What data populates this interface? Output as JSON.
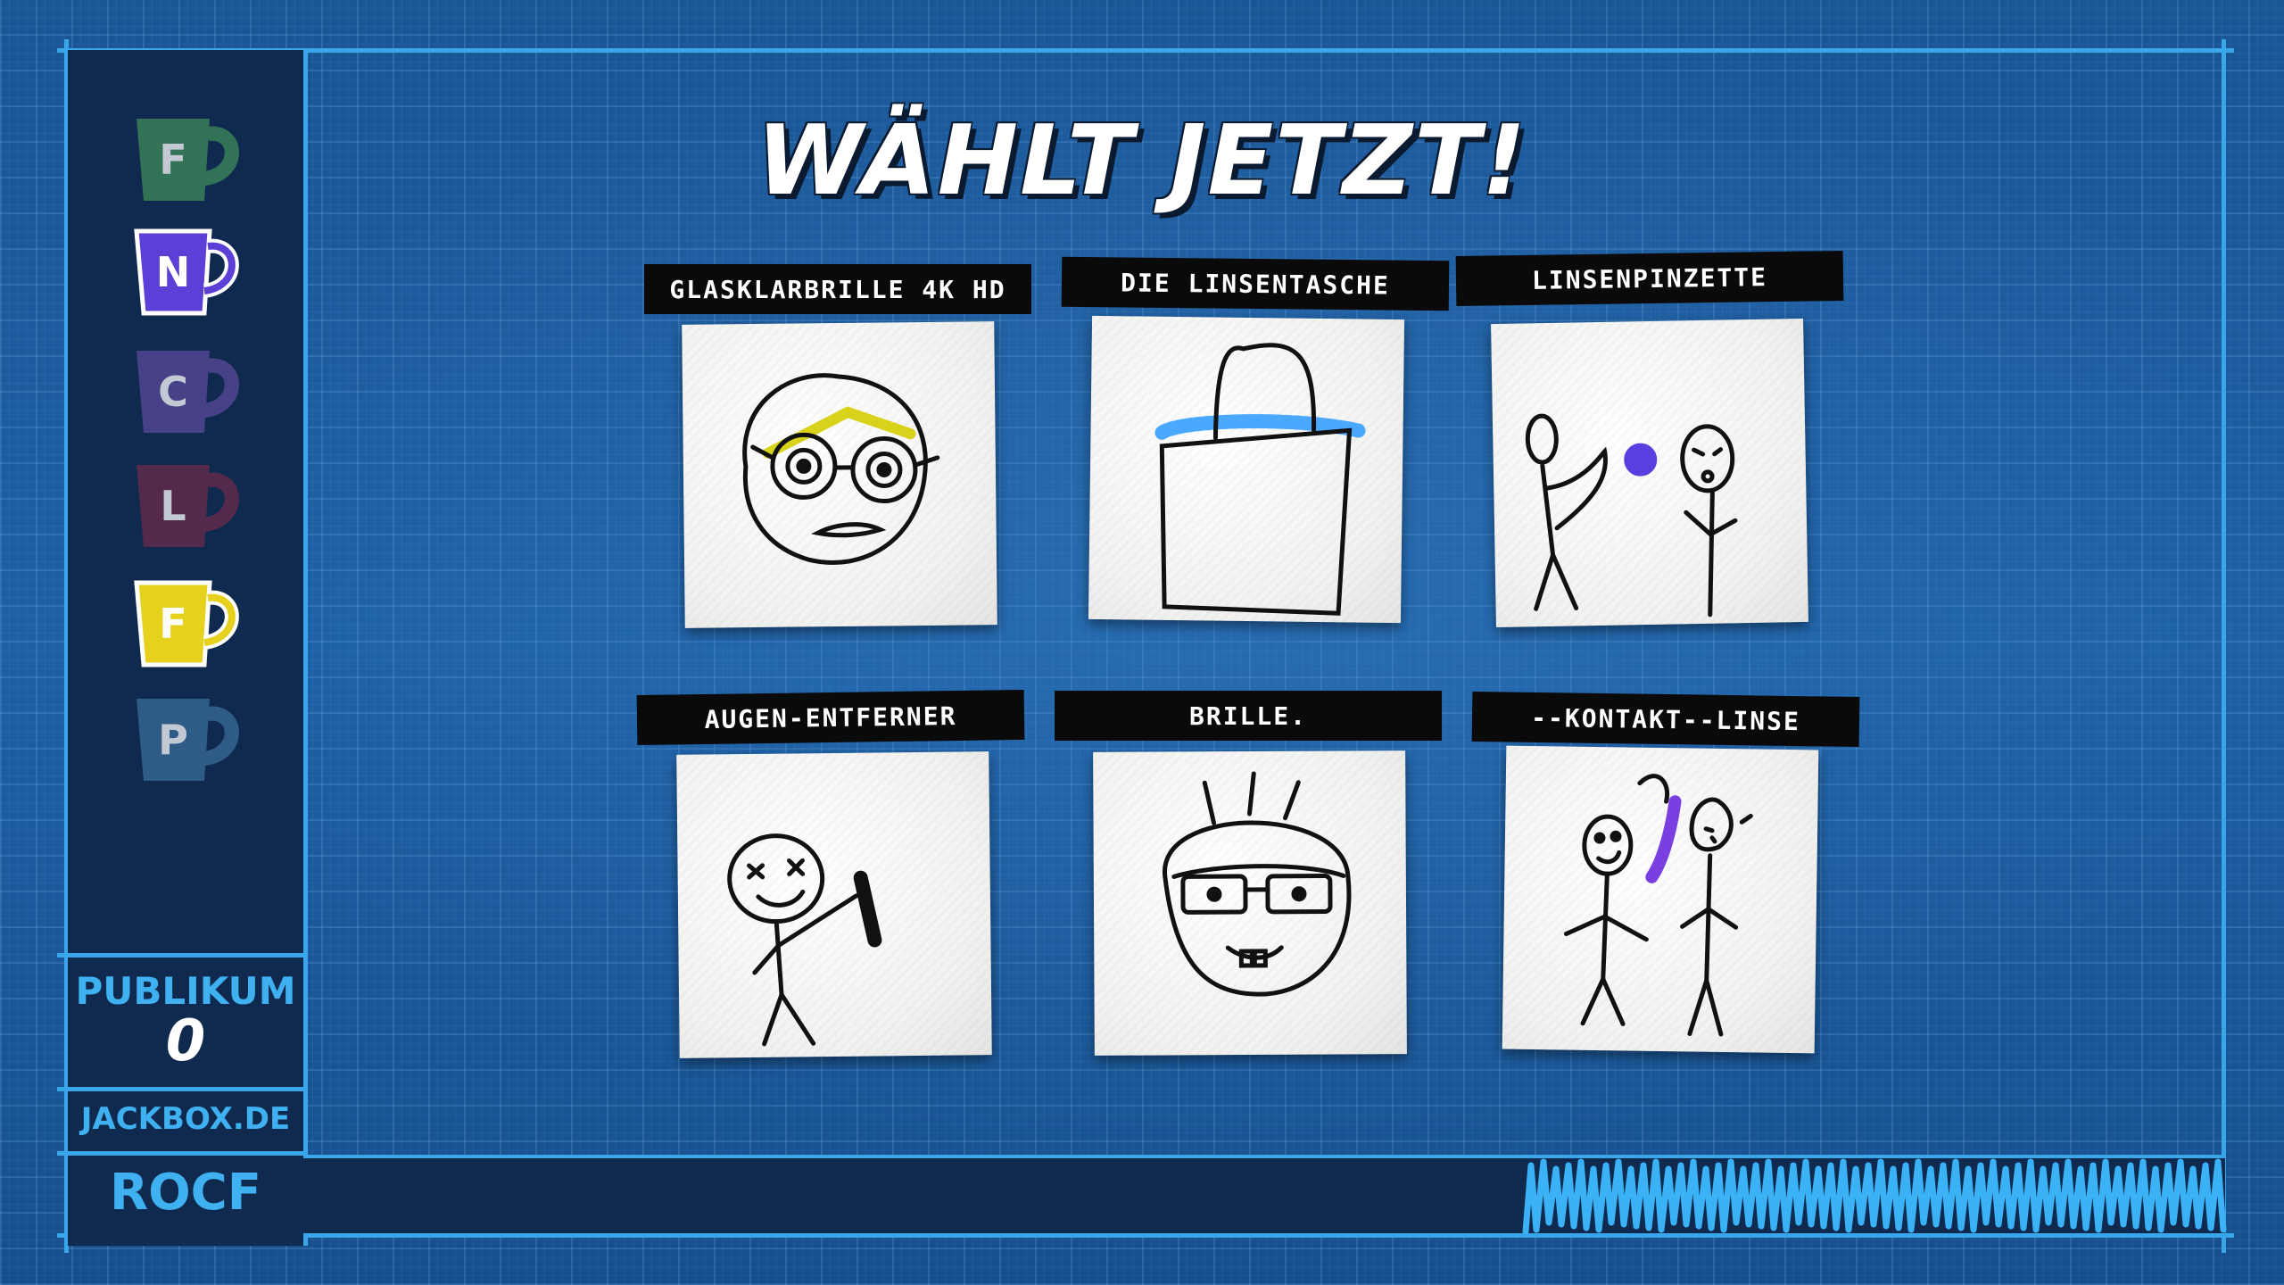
{
  "title": "WÄHLT JETZT!",
  "players": [
    {
      "letter": "F",
      "color": "#3e8a5a",
      "state": "dimmed"
    },
    {
      "letter": "N",
      "color": "#5b3fd6",
      "state": "active"
    },
    {
      "letter": "C",
      "color": "#5a4a9c",
      "state": "dimmed"
    },
    {
      "letter": "L",
      "color": "#6a2a4a",
      "state": "dimmed"
    },
    {
      "letter": "F",
      "color": "#e6d21c",
      "state": "active"
    },
    {
      "letter": "P",
      "color": "#3a6c9a",
      "state": "dimmed"
    }
  ],
  "audience": {
    "label": "PUBLIKUM",
    "count": "0"
  },
  "site": "JACKBOX.DE",
  "room_code": "ROCF",
  "entries": [
    {
      "label": "GLASKLARBRILLE 4K HD",
      "drawing": "face-with-glasses"
    },
    {
      "label": "DIE LINSENTASCHE",
      "drawing": "tote-bag"
    },
    {
      "label": "LINSENPINZETTE",
      "drawing": "stick-figures-tweezers"
    },
    {
      "label": "AUGEN-ENTFERNER",
      "drawing": "stick-figure-with-tool"
    },
    {
      "label": "BRILLE.",
      "drawing": "face-with-glasses-and-hair"
    },
    {
      "label": "--KONTAKT--LINSE",
      "drawing": "two-stick-figures"
    }
  ],
  "colors": {
    "accent": "#3aa6ea",
    "background": "#1d5a9a",
    "panel": "#0f2a4e"
  }
}
